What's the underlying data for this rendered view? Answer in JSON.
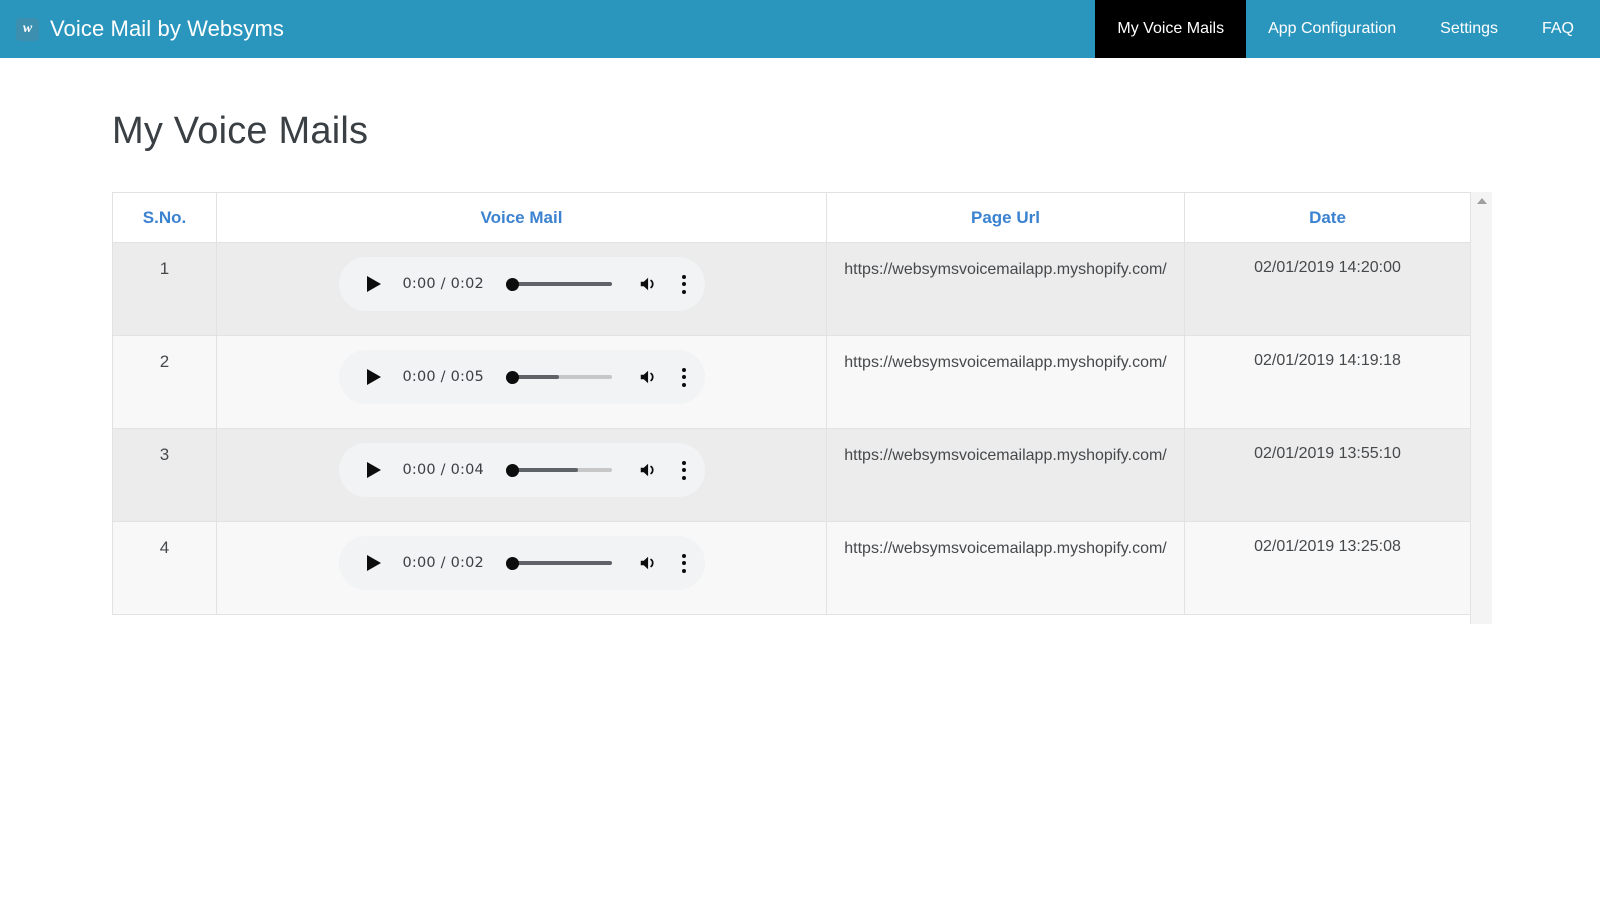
{
  "topbar": {
    "logo_glyph": "w",
    "logo_icon": "websyms-logo-icon",
    "title": "Voice Mail by Websyms",
    "nav": [
      {
        "label": "My Voice Mails",
        "active": true
      },
      {
        "label": "App Configuration",
        "active": false
      },
      {
        "label": "Settings",
        "active": false
      },
      {
        "label": "FAQ",
        "active": false
      }
    ],
    "bg_color": "#2b96bd",
    "active_bg_color": "#000000"
  },
  "page": {
    "title": "My Voice Mails"
  },
  "table": {
    "headers": [
      "S.No.",
      "Voice Mail",
      "Page Url",
      "Date"
    ],
    "header_color": "#3b82d0",
    "rows": [
      {
        "sno": "1",
        "player": {
          "current_time": "0:00",
          "duration": "0:02",
          "time_display": "0:00 / 0:02",
          "buffered_percent": 100,
          "played_percent": 0,
          "play_icon": "play-icon",
          "volume_icon": "volume-icon",
          "menu_icon": "more-vertical-icon"
        },
        "url": "https://websymsvoicemailapp.myshopify.com/",
        "date": "02/01/2019 14:20:00"
      },
      {
        "sno": "2",
        "player": {
          "current_time": "0:00",
          "duration": "0:05",
          "time_display": "0:00 / 0:05",
          "buffered_percent": 50,
          "played_percent": 0,
          "play_icon": "play-icon",
          "volume_icon": "volume-icon",
          "menu_icon": "more-vertical-icon"
        },
        "url": "https://websymsvoicemailapp.myshopify.com/",
        "date": "02/01/2019 14:19:18"
      },
      {
        "sno": "3",
        "player": {
          "current_time": "0:00",
          "duration": "0:04",
          "time_display": "0:00 / 0:04",
          "buffered_percent": 68,
          "played_percent": 0,
          "play_icon": "play-icon",
          "volume_icon": "volume-icon",
          "menu_icon": "more-vertical-icon"
        },
        "url": "https://websymsvoicemailapp.myshopify.com/",
        "date": "02/01/2019 13:55:10"
      },
      {
        "sno": "4",
        "player": {
          "current_time": "0:00",
          "duration": "0:02",
          "time_display": "0:00 / 0:02",
          "buffered_percent": 100,
          "played_percent": 0,
          "play_icon": "play-icon",
          "volume_icon": "volume-icon",
          "menu_icon": "more-vertical-icon"
        },
        "url": "https://websymsvoicemailapp.myshopify.com/",
        "date": "02/01/2019 13:25:08"
      }
    ]
  },
  "scrollbar": {
    "up_arrow_icon": "scroll-up-arrow-icon",
    "orientation": "vertical"
  }
}
